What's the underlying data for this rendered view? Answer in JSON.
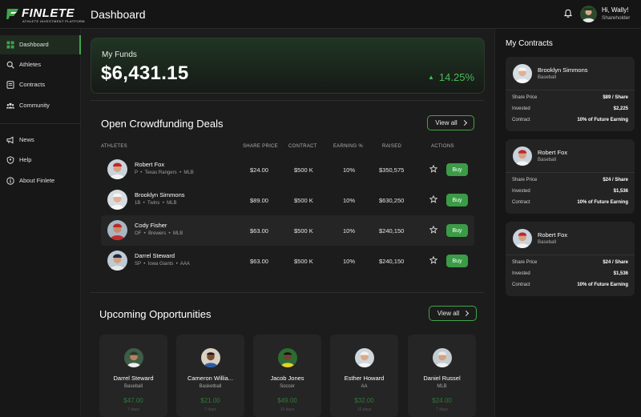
{
  "brand": {
    "name": "FINLETE",
    "tagline": "ATHLETE INVESTMENT PLATFORM",
    "accent": "#3fa54a"
  },
  "header": {
    "title": "Dashboard",
    "greeting": "Hi, Wally!",
    "role": "Shareholder"
  },
  "sidebar": {
    "items": [
      {
        "label": "Dashboard",
        "icon": "grid-icon",
        "active": true
      },
      {
        "label": "Athletes",
        "icon": "search-icon"
      },
      {
        "label": "Contracts",
        "icon": "contract-icon"
      },
      {
        "label": "Community",
        "icon": "community-icon"
      },
      {
        "label": "News",
        "icon": "megaphone-icon"
      },
      {
        "label": "Help",
        "icon": "help-icon"
      },
      {
        "label": "About Finlete",
        "icon": "info-icon"
      }
    ]
  },
  "funds": {
    "label": "My Funds",
    "value": "$6,431.15",
    "change": "14.25%"
  },
  "deals": {
    "title": "Open Crowdfunding Deals",
    "view_all": "View all",
    "columns": [
      "ATHLETES",
      "SHARE PRICE",
      "CONTRACT",
      "EARNING %",
      "RAISED",
      "ACTIONS"
    ],
    "rows": [
      {
        "name": "Robert Fox",
        "pos": "P",
        "team": "Texas Rangers",
        "league": "MLB",
        "price": "$24.00",
        "contract": "$500 K",
        "earning": "10%",
        "raised": "$350,575",
        "action": "Buy"
      },
      {
        "name": "Brooklyn Simmons",
        "pos": "1B",
        "team": "Twins",
        "league": "MLB",
        "price": "$89.00",
        "contract": "$500 K",
        "earning": "10%",
        "raised": "$630,250",
        "action": "Buy"
      },
      {
        "name": "Cody Fisher",
        "pos": "OF",
        "team": "Brewers",
        "league": "MLB",
        "price": "$63.00",
        "contract": "$500 K",
        "earning": "10%",
        "raised": "$240,150",
        "action": "Buy"
      },
      {
        "name": "Darrel Steward",
        "pos": "SP",
        "team": "Iowa Giants",
        "league": "AAA",
        "price": "$63.00",
        "contract": "$500 K",
        "earning": "10%",
        "raised": "$240,150",
        "action": "Buy"
      }
    ]
  },
  "opportunities": {
    "title": "Upcoming Opportunities",
    "view_all": "View all",
    "cards": [
      {
        "name": "Darrel Steward",
        "sport": "Baseball",
        "price": "$47.00",
        "sub": "7 days"
      },
      {
        "name": "Cameron Willia...",
        "sport": "Basketball",
        "price": "$21.00",
        "sub": "7 days"
      },
      {
        "name": "Jacob Jones",
        "sport": "Soccer",
        "price": "$49.00",
        "sub": "10 days"
      },
      {
        "name": "Esther Howard",
        "sport": "AA",
        "price": "$32.00",
        "sub": "10 days"
      },
      {
        "name": "Daniel Russel",
        "sport": "MLB",
        "price": "$24.00",
        "sub": "7 days"
      }
    ]
  },
  "contracts": {
    "title": "My Contracts",
    "labels": {
      "price": "Share Price",
      "invested": "Invested",
      "contract": "Contract"
    },
    "items": [
      {
        "name": "Brooklyn Simmons",
        "sport": "Baseball",
        "price": "$89 / Share",
        "invested": "$2,225",
        "contract": "10% of Future Earning"
      },
      {
        "name": "Robert Fox",
        "sport": "Baseball",
        "price": "$24 / Share",
        "invested": "$1,536",
        "contract": "10% of Future Earning"
      },
      {
        "name": "Robert Fox",
        "sport": "Baseball",
        "price": "$24 / Share",
        "invested": "$1,536",
        "contract": "10% of Future Earning"
      }
    ]
  }
}
